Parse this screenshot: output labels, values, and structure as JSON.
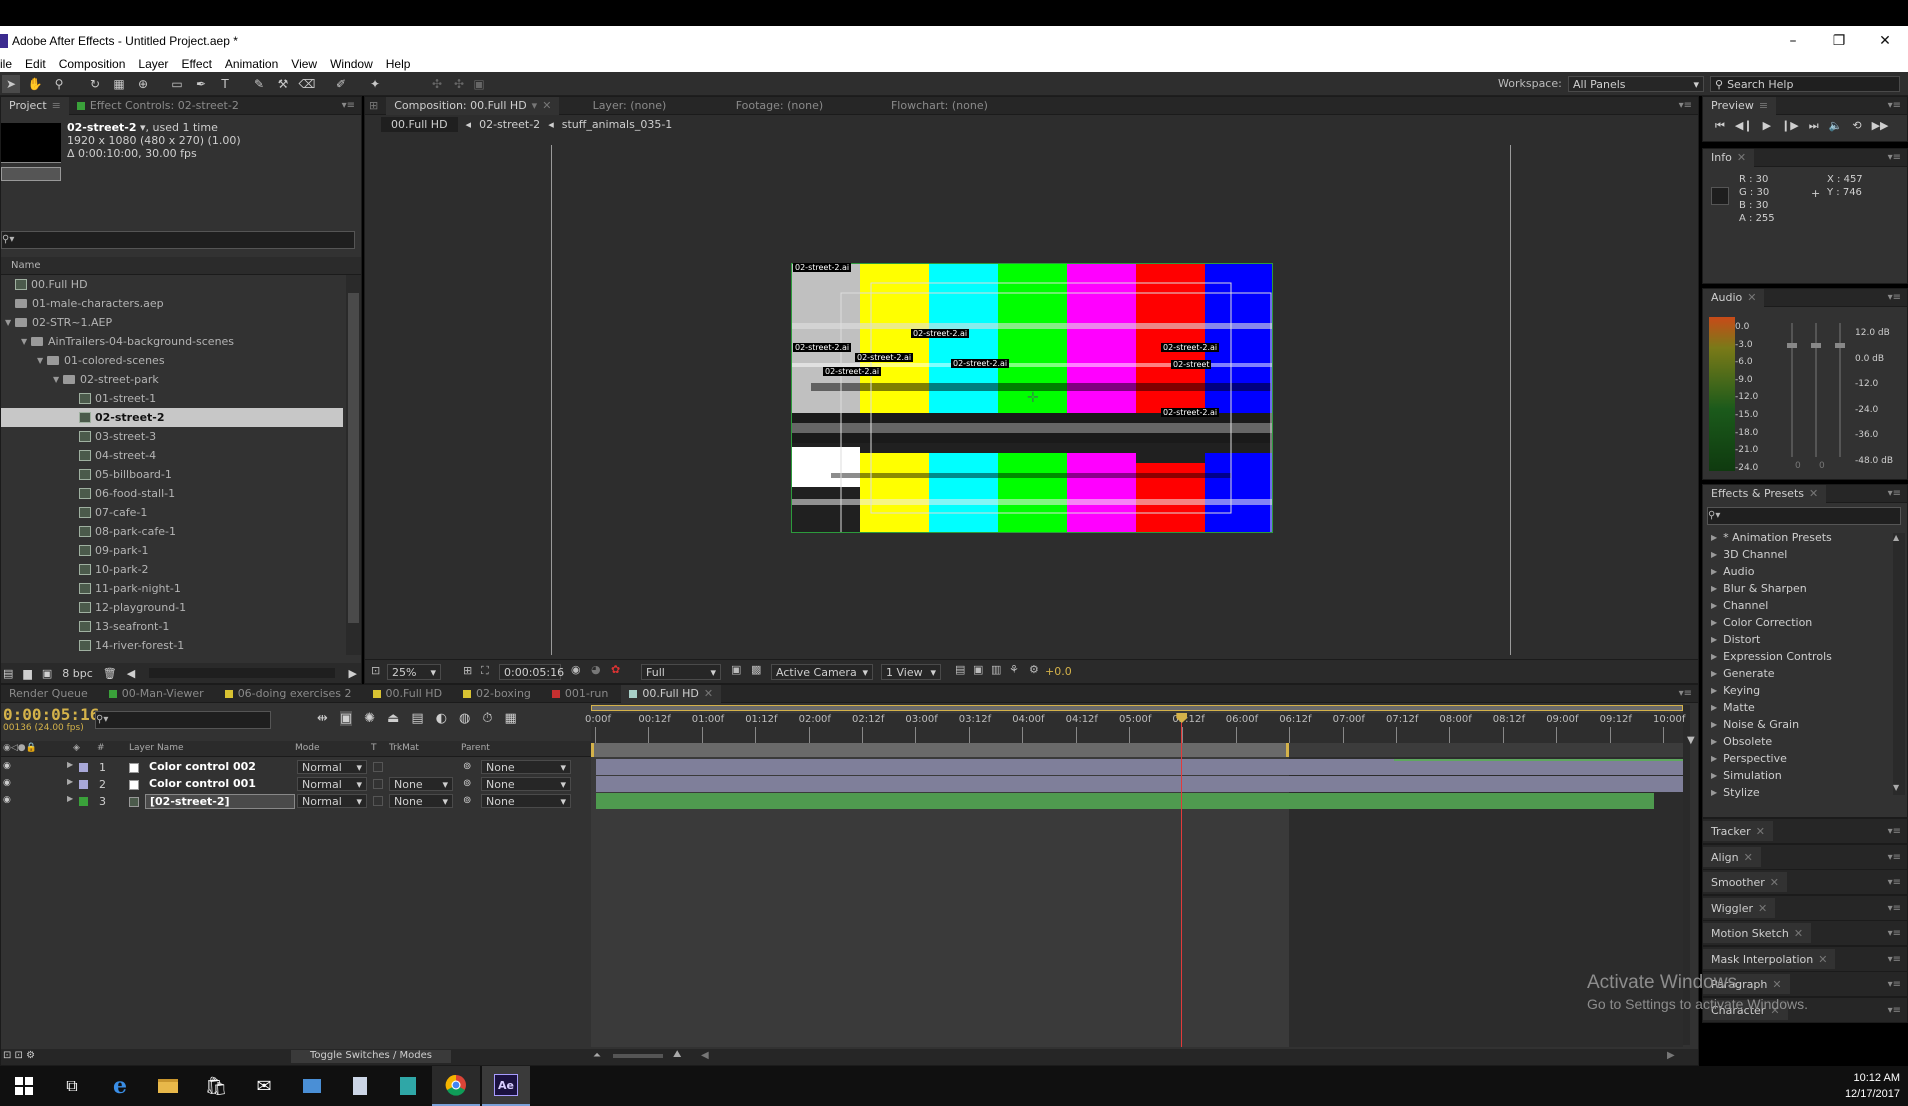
{
  "window": {
    "title": "Adobe After Effects - Untitled Project.aep *",
    "min": "–",
    "max": "❐",
    "close": "✕"
  },
  "menu": [
    "ile",
    "Edit",
    "Composition",
    "Layer",
    "Effect",
    "Animation",
    "View",
    "Window",
    "Help"
  ],
  "toolbar": {
    "workspace_label": "Workspace:",
    "workspace_value": "All Panels",
    "search_placeholder": "Search Help"
  },
  "project": {
    "tab_project": "Project",
    "tab_effect": "Effect Controls: 02-street-2",
    "item_name": "02-street-2",
    "item_used": ", used 1 time",
    "item_res": "1920 x 1080  (480 x 270) (1.00)",
    "item_dur": "Δ 0:00:10:00, 30.00 fps",
    "col_name": "Name",
    "bpc": "8 bpc",
    "items": [
      {
        "label": "00.Full HD",
        "indent": 0,
        "kind": "comp",
        "tri": ""
      },
      {
        "label": "01-male-characters.aep",
        "indent": 0,
        "kind": "folder",
        "tri": ""
      },
      {
        "label": "02-STR~1.AEP",
        "indent": 0,
        "kind": "folder",
        "tri": "▼"
      },
      {
        "label": "AinTrailers-04-background-scenes",
        "indent": 1,
        "kind": "folder",
        "tri": "▼"
      },
      {
        "label": "01-colored-scenes",
        "indent": 2,
        "kind": "folder",
        "tri": "▼"
      },
      {
        "label": "02-street-park",
        "indent": 3,
        "kind": "folder",
        "tri": "▼"
      },
      {
        "label": "01-street-1",
        "indent": 4,
        "kind": "comp",
        "tri": ""
      },
      {
        "label": "02-street-2",
        "indent": 4,
        "kind": "comp",
        "tri": "",
        "selected": true
      },
      {
        "label": "03-street-3",
        "indent": 4,
        "kind": "comp",
        "tri": ""
      },
      {
        "label": "04-street-4",
        "indent": 4,
        "kind": "comp",
        "tri": ""
      },
      {
        "label": "05-billboard-1",
        "indent": 4,
        "kind": "comp",
        "tri": ""
      },
      {
        "label": "06-food-stall-1",
        "indent": 4,
        "kind": "comp",
        "tri": ""
      },
      {
        "label": "07-cafe-1",
        "indent": 4,
        "kind": "comp",
        "tri": ""
      },
      {
        "label": "08-park-cafe-1",
        "indent": 4,
        "kind": "comp",
        "tri": ""
      },
      {
        "label": "09-park-1",
        "indent": 4,
        "kind": "comp",
        "tri": ""
      },
      {
        "label": "10-park-2",
        "indent": 4,
        "kind": "comp",
        "tri": ""
      },
      {
        "label": "11-park-night-1",
        "indent": 4,
        "kind": "comp",
        "tri": ""
      },
      {
        "label": "12-playground-1",
        "indent": 4,
        "kind": "comp",
        "tri": ""
      },
      {
        "label": "13-seafront-1",
        "indent": 4,
        "kind": "comp",
        "tri": ""
      },
      {
        "label": "14-river-forest-1",
        "indent": 4,
        "kind": "comp",
        "tri": ""
      }
    ]
  },
  "viewer": {
    "tab_comp": "Composition: 00.Full HD",
    "tab_layer": "Layer: (none)",
    "tab_footage": "Footage: (none)",
    "tab_flowchart": "Flowchart: (none)",
    "crumbs": [
      "00.Full HD",
      "02-street-2",
      "stuff_animals_035-1"
    ],
    "zoom": "25%",
    "timecode": "0:00:05:16",
    "resolution": "Full",
    "camera": "Active Camera",
    "views": "1 View",
    "exposure": "+0.0",
    "layer_labels": [
      "02-street-2.ai",
      "02-street-2.ai",
      "02-street-2.ai",
      "02-street-2.ai",
      "02-street-2.ai",
      "02-street-2.ai",
      "02-street-2.ai",
      "02-street",
      "02-street-2.ai"
    ]
  },
  "preview": {
    "tab": "Preview"
  },
  "info": {
    "tab": "Info",
    "r": "R : 30",
    "g": "G : 30",
    "b": "B : 30",
    "a": "A : 255",
    "x": "X : 457",
    "y": "Y : 746",
    "swatch": "#1e1e1e"
  },
  "audio": {
    "tab": "Audio",
    "left_labels": [
      "0.0",
      "-3.0",
      "-6.0",
      "-9.0",
      "-12.0",
      "-15.0",
      "-18.0",
      "-21.0",
      "-24.0"
    ],
    "right_labels": [
      "12.0 dB",
      "0.0 dB",
      "-12.0",
      "-24.0",
      "-36.0",
      "-48.0 dB"
    ],
    "zero_a": "0",
    "zero_b": "0"
  },
  "effects": {
    "tab": "Effects & Presets",
    "items": [
      "* Animation Presets",
      "3D Channel",
      "Audio",
      "Blur & Sharpen",
      "Channel",
      "Color Correction",
      "Distort",
      "Expression Controls",
      "Generate",
      "Keying",
      "Matte",
      "Noise & Grain",
      "Obsolete",
      "Perspective",
      "Simulation",
      "Stylize"
    ]
  },
  "collapsed_panels": [
    "Tracker",
    "Align",
    "Smoother",
    "Wiggler",
    "Motion Sketch",
    "Mask Interpolation",
    "Paragraph",
    "Character"
  ],
  "timeline": {
    "tabs": [
      {
        "label": "Render Queue",
        "color": ""
      },
      {
        "label": "00-Man-Viewer",
        "color": "#3aa13a"
      },
      {
        "label": "06-doing exercises 2",
        "color": "#d8c232"
      },
      {
        "label": "00.Full HD",
        "color": "#d8c232"
      },
      {
        "label": "02-boxing",
        "color": "#d8c232"
      },
      {
        "label": "001-run",
        "color": "#c63030"
      },
      {
        "label": "00.Full HD",
        "color": "#a8d0c8",
        "active": true
      }
    ],
    "timecode": "0:00:05:16",
    "frames": "00136 (24.00 fps)",
    "col_layer": "Layer Name",
    "col_mode": "Mode",
    "col_t": "T",
    "col_trkmat": "TrkMat",
    "col_parent": "Parent",
    "col_num": "#",
    "layers": [
      {
        "num": "1",
        "name": "Color control 002",
        "mode": "Normal",
        "trkmat": "",
        "parent": "None",
        "label": "#a8a8d8"
      },
      {
        "num": "2",
        "name": "Color control 001",
        "mode": "Normal",
        "trkmat": "None",
        "parent": "None",
        "label": "#a8a8d8"
      },
      {
        "num": "3",
        "name": "[02-street-2]",
        "mode": "Normal",
        "trkmat": "None",
        "parent": "None",
        "label": "#3aa13a"
      }
    ],
    "ruler": [
      "0:00f",
      "00:12f",
      "01:00f",
      "01:12f",
      "02:00f",
      "02:12f",
      "03:00f",
      "03:12f",
      "04:00f",
      "04:12f",
      "05:00f",
      "05:12f",
      "06:00f",
      "06:12f",
      "07:00f",
      "07:12f",
      "08:00f",
      "08:12f",
      "09:00f",
      "09:12f",
      "10:00f"
    ],
    "toggle_label": "Toggle Switches / Modes",
    "playhead_time_fraction": 0.549
  },
  "watermark": {
    "line1": "Activate Windows",
    "line2": "Go to Settings to activate Windows."
  },
  "taskbar": {
    "time": "10:12 AM",
    "date": "12/17/2017",
    "ae_label": "Ae"
  }
}
